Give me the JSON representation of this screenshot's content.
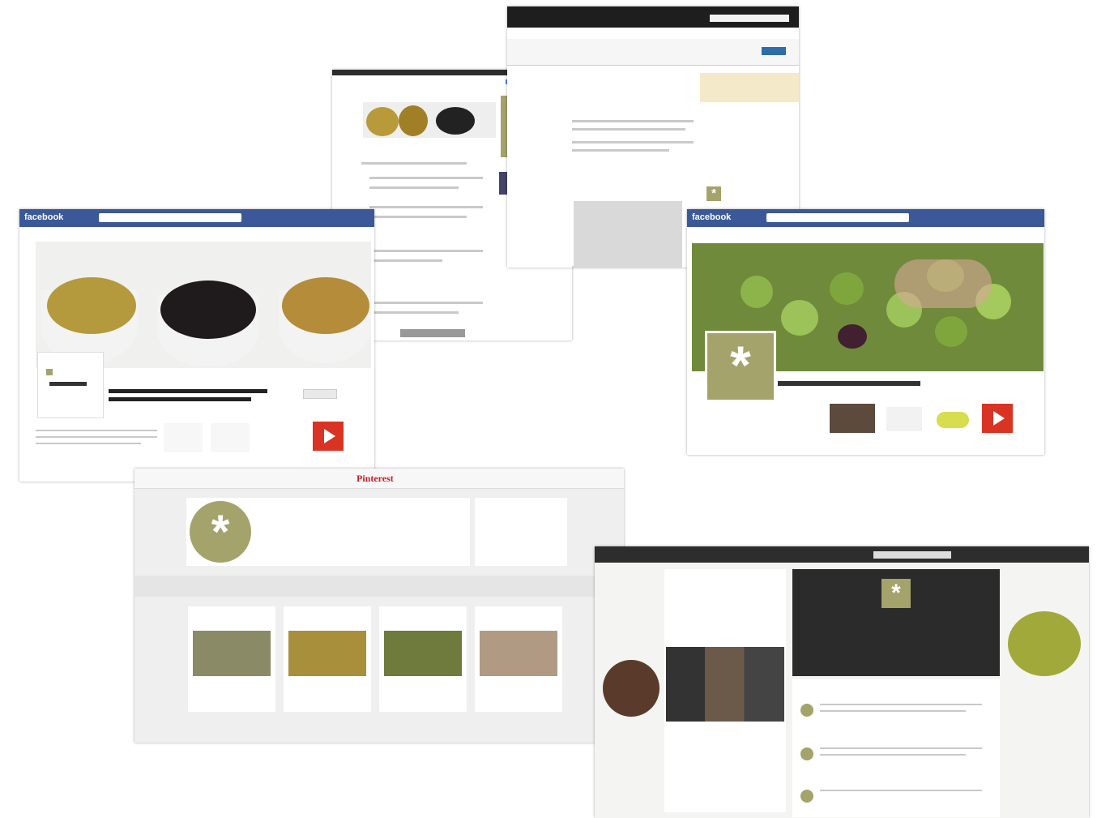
{
  "colors": {
    "facebook_blue": "#3b5998",
    "brand_olive": "#a3a36b",
    "youtube_red": "#d93323",
    "pinterest_red": "#cb2027",
    "twitter_dark": "#2d2d2d"
  },
  "screens": {
    "facebook_1": {
      "logo_text": "facebook"
    },
    "facebook_2": {
      "logo_text": "facebook"
    },
    "pinterest": {
      "logo_text": "Pinterest"
    }
  },
  "icons": [
    "star-logo-icon",
    "youtube-play-icon"
  ]
}
